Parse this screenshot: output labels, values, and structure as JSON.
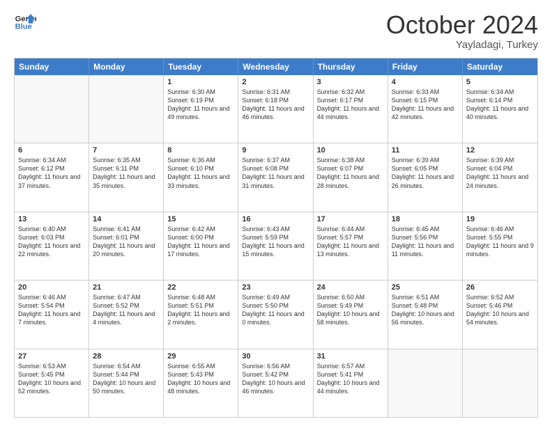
{
  "logo": {
    "line1": "General",
    "line2": "Blue"
  },
  "header": {
    "month": "October 2024",
    "location": "Yayladagi, Turkey"
  },
  "days": [
    "Sunday",
    "Monday",
    "Tuesday",
    "Wednesday",
    "Thursday",
    "Friday",
    "Saturday"
  ],
  "rows": [
    [
      {
        "day": "",
        "empty": true
      },
      {
        "day": "",
        "empty": true
      },
      {
        "day": "1",
        "line1": "Sunrise: 6:30 AM",
        "line2": "Sunset: 6:19 PM",
        "line3": "Daylight: 11 hours and 49 minutes."
      },
      {
        "day": "2",
        "line1": "Sunrise: 6:31 AM",
        "line2": "Sunset: 6:18 PM",
        "line3": "Daylight: 11 hours and 46 minutes."
      },
      {
        "day": "3",
        "line1": "Sunrise: 6:32 AM",
        "line2": "Sunset: 6:17 PM",
        "line3": "Daylight: 11 hours and 44 minutes."
      },
      {
        "day": "4",
        "line1": "Sunrise: 6:33 AM",
        "line2": "Sunset: 6:15 PM",
        "line3": "Daylight: 11 hours and 42 minutes."
      },
      {
        "day": "5",
        "line1": "Sunrise: 6:34 AM",
        "line2": "Sunset: 6:14 PM",
        "line3": "Daylight: 11 hours and 40 minutes."
      }
    ],
    [
      {
        "day": "6",
        "line1": "Sunrise: 6:34 AM",
        "line2": "Sunset: 6:12 PM",
        "line3": "Daylight: 11 hours and 37 minutes."
      },
      {
        "day": "7",
        "line1": "Sunrise: 6:35 AM",
        "line2": "Sunset: 6:11 PM",
        "line3": "Daylight: 11 hours and 35 minutes."
      },
      {
        "day": "8",
        "line1": "Sunrise: 6:36 AM",
        "line2": "Sunset: 6:10 PM",
        "line3": "Daylight: 11 hours and 33 minutes."
      },
      {
        "day": "9",
        "line1": "Sunrise: 6:37 AM",
        "line2": "Sunset: 6:08 PM",
        "line3": "Daylight: 11 hours and 31 minutes."
      },
      {
        "day": "10",
        "line1": "Sunrise: 6:38 AM",
        "line2": "Sunset: 6:07 PM",
        "line3": "Daylight: 11 hours and 28 minutes."
      },
      {
        "day": "11",
        "line1": "Sunrise: 6:39 AM",
        "line2": "Sunset: 6:05 PM",
        "line3": "Daylight: 11 hours and 26 minutes."
      },
      {
        "day": "12",
        "line1": "Sunrise: 6:39 AM",
        "line2": "Sunset: 6:04 PM",
        "line3": "Daylight: 11 hours and 24 minutes."
      }
    ],
    [
      {
        "day": "13",
        "line1": "Sunrise: 6:40 AM",
        "line2": "Sunset: 6:03 PM",
        "line3": "Daylight: 11 hours and 22 minutes."
      },
      {
        "day": "14",
        "line1": "Sunrise: 6:41 AM",
        "line2": "Sunset: 6:01 PM",
        "line3": "Daylight: 11 hours and 20 minutes."
      },
      {
        "day": "15",
        "line1": "Sunrise: 6:42 AM",
        "line2": "Sunset: 6:00 PM",
        "line3": "Daylight: 11 hours and 17 minutes."
      },
      {
        "day": "16",
        "line1": "Sunrise: 6:43 AM",
        "line2": "Sunset: 5:59 PM",
        "line3": "Daylight: 11 hours and 15 minutes."
      },
      {
        "day": "17",
        "line1": "Sunrise: 6:44 AM",
        "line2": "Sunset: 5:57 PM",
        "line3": "Daylight: 11 hours and 13 minutes."
      },
      {
        "day": "18",
        "line1": "Sunrise: 6:45 AM",
        "line2": "Sunset: 5:56 PM",
        "line3": "Daylight: 11 hours and 11 minutes."
      },
      {
        "day": "19",
        "line1": "Sunrise: 6:46 AM",
        "line2": "Sunset: 5:55 PM",
        "line3": "Daylight: 11 hours and 9 minutes."
      }
    ],
    [
      {
        "day": "20",
        "line1": "Sunrise: 6:46 AM",
        "line2": "Sunset: 5:54 PM",
        "line3": "Daylight: 11 hours and 7 minutes."
      },
      {
        "day": "21",
        "line1": "Sunrise: 6:47 AM",
        "line2": "Sunset: 5:52 PM",
        "line3": "Daylight: 11 hours and 4 minutes."
      },
      {
        "day": "22",
        "line1": "Sunrise: 6:48 AM",
        "line2": "Sunset: 5:51 PM",
        "line3": "Daylight: 11 hours and 2 minutes."
      },
      {
        "day": "23",
        "line1": "Sunrise: 6:49 AM",
        "line2": "Sunset: 5:50 PM",
        "line3": "Daylight: 11 hours and 0 minutes."
      },
      {
        "day": "24",
        "line1": "Sunrise: 6:50 AM",
        "line2": "Sunset: 5:49 PM",
        "line3": "Daylight: 10 hours and 58 minutes."
      },
      {
        "day": "25",
        "line1": "Sunrise: 6:51 AM",
        "line2": "Sunset: 5:48 PM",
        "line3": "Daylight: 10 hours and 56 minutes."
      },
      {
        "day": "26",
        "line1": "Sunrise: 6:52 AM",
        "line2": "Sunset: 5:46 PM",
        "line3": "Daylight: 10 hours and 54 minutes."
      }
    ],
    [
      {
        "day": "27",
        "line1": "Sunrise: 6:53 AM",
        "line2": "Sunset: 5:45 PM",
        "line3": "Daylight: 10 hours and 52 minutes."
      },
      {
        "day": "28",
        "line1": "Sunrise: 6:54 AM",
        "line2": "Sunset: 5:44 PM",
        "line3": "Daylight: 10 hours and 50 minutes."
      },
      {
        "day": "29",
        "line1": "Sunrise: 6:55 AM",
        "line2": "Sunset: 5:43 PM",
        "line3": "Daylight: 10 hours and 48 minutes."
      },
      {
        "day": "30",
        "line1": "Sunrise: 6:56 AM",
        "line2": "Sunset: 5:42 PM",
        "line3": "Daylight: 10 hours and 46 minutes."
      },
      {
        "day": "31",
        "line1": "Sunrise: 6:57 AM",
        "line2": "Sunset: 5:41 PM",
        "line3": "Daylight: 10 hours and 44 minutes."
      },
      {
        "day": "",
        "empty": true
      },
      {
        "day": "",
        "empty": true
      }
    ]
  ]
}
